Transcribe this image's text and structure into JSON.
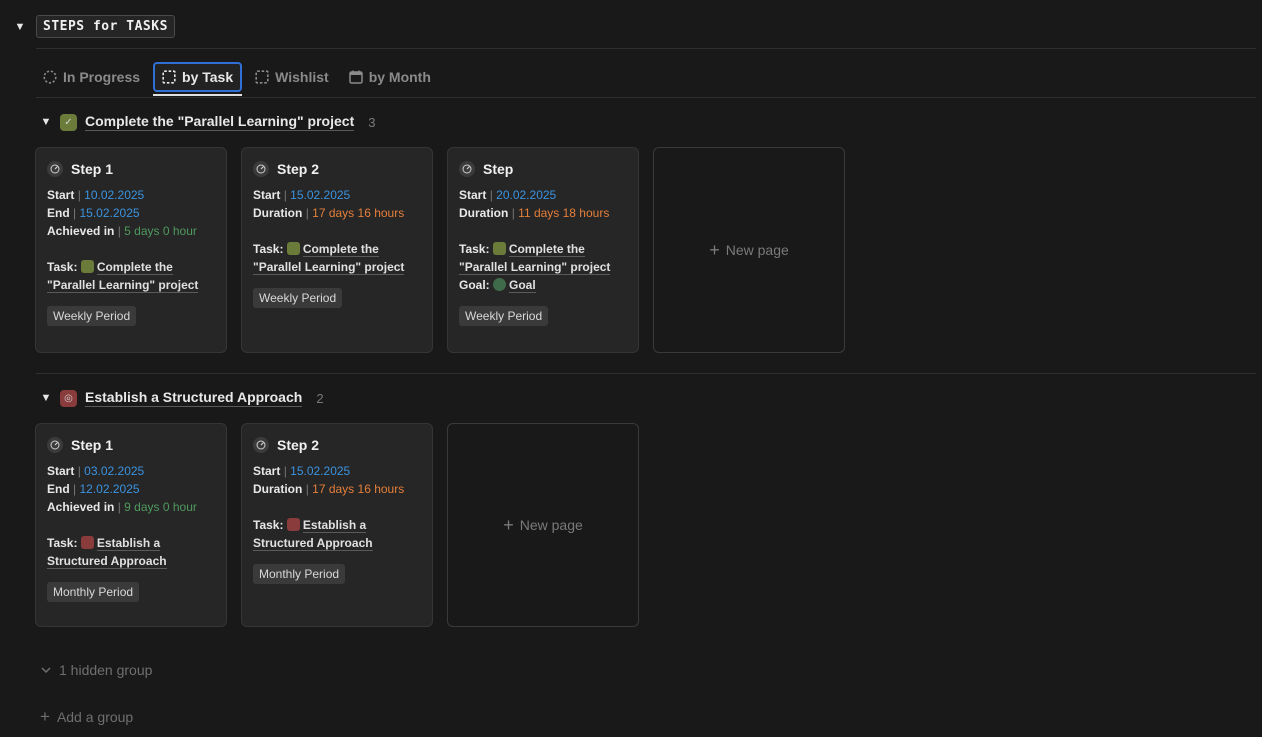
{
  "database": {
    "title": "STEPS for TASKS",
    "toggle_icon": "caret-down-icon"
  },
  "tabs": [
    {
      "label": "In Progress",
      "icon": "dashed-circle-icon",
      "active": false
    },
    {
      "label": "by Task",
      "icon": "dashed-square-icon",
      "active": true
    },
    {
      "label": "Wishlist",
      "icon": "dashed-square-icon",
      "active": false
    },
    {
      "label": "by Month",
      "icon": "calendar-icon",
      "active": false
    }
  ],
  "groups": [
    {
      "title": "Complete the \"Parallel Learning\" project",
      "count": "3",
      "emoji_color": "#6b7b3a",
      "cards": [
        {
          "title": "Step 1",
          "lines": [
            {
              "label": "Start",
              "value": "10.02.2025",
              "color": "blue"
            },
            {
              "label": "End",
              "value": "15.02.2025",
              "color": "blue"
            },
            {
              "label": "Achieved in",
              "value": "5 days 0 hour",
              "color": "green"
            }
          ],
          "task_label": "Task:",
          "task": "Complete the \"Parallel Learning\" project",
          "tag": "Weekly Period"
        },
        {
          "title": "Step 2",
          "lines": [
            {
              "label": "Start",
              "value": "15.02.2025",
              "color": "blue"
            },
            {
              "label": "Duration",
              "value": "17 days 16 hours",
              "color": "orange"
            }
          ],
          "task_label": "Task:",
          "task": "Complete the \"Parallel Learning\" project",
          "tag": "Weekly Period"
        },
        {
          "title": "Step",
          "lines": [
            {
              "label": "Start",
              "value": "20.02.2025",
              "color": "blue"
            },
            {
              "label": "Duration",
              "value": "11 days 18 hours",
              "color": "orange"
            }
          ],
          "task_label": "Task:",
          "task": "Complete the \"Parallel Learning\" project",
          "goal_label": "Goal:",
          "goal": "Goal",
          "tag": "Weekly Period"
        }
      ],
      "new_page": "New page"
    },
    {
      "title": "Establish a Structured Approach",
      "count": "2",
      "emoji_color": "#8a3b3b",
      "cards": [
        {
          "title": "Step 1",
          "lines": [
            {
              "label": "Start",
              "value": "03.02.2025",
              "color": "blue"
            },
            {
              "label": "End",
              "value": "12.02.2025",
              "color": "blue"
            },
            {
              "label": "Achieved in",
              "value": "9 days 0 hour",
              "color": "green"
            }
          ],
          "task_label": "Task:",
          "task": "Establish a Structured Approach",
          "tag": "Monthly Period"
        },
        {
          "title": "Step 2",
          "lines": [
            {
              "label": "Start",
              "value": "15.02.2025",
              "color": "blue"
            },
            {
              "label": "Duration",
              "value": "17 days 16 hours",
              "color": "orange"
            }
          ],
          "task_label": "Task:",
          "task": "Establish a Structured Approach",
          "tag": "Monthly Period"
        }
      ],
      "new_page": "New page"
    }
  ],
  "footer": {
    "hidden_group": "1 hidden group",
    "add_group": "Add a group"
  }
}
